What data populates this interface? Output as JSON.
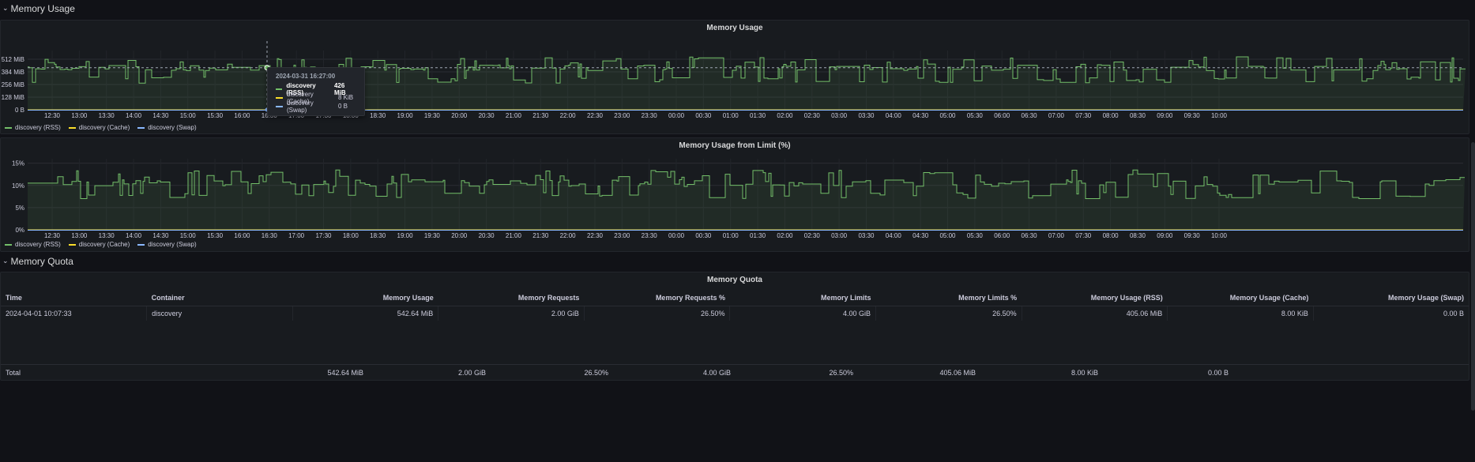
{
  "rows": {
    "memory_usage": "Memory Usage",
    "memory_quota": "Memory Quota"
  },
  "legend": [
    {
      "name": "discovery (RSS)",
      "color": "#73bf69"
    },
    {
      "name": "discovery (Cache)",
      "color": "#fade2a"
    },
    {
      "name": "discovery (Swap)",
      "color": "#8ab8ff"
    }
  ],
  "x_ticks": [
    "12:30",
    "13:00",
    "13:30",
    "14:00",
    "14:30",
    "15:00",
    "15:30",
    "16:00",
    "16:30",
    "17:00",
    "17:30",
    "18:00",
    "18:30",
    "19:00",
    "19:30",
    "20:00",
    "20:30",
    "21:00",
    "21:30",
    "22:00",
    "22:30",
    "23:00",
    "23:30",
    "00:00",
    "00:30",
    "01:00",
    "01:30",
    "02:00",
    "02:30",
    "03:00",
    "03:30",
    "04:00",
    "04:30",
    "05:00",
    "05:30",
    "06:00",
    "06:30",
    "07:00",
    "07:30",
    "08:00",
    "08:30",
    "09:00",
    "09:30",
    "10:00"
  ],
  "panel1": {
    "title": "Memory Usage",
    "y_ticks": [
      "0 B",
      "128 MiB",
      "256 MiB",
      "384 MiB",
      "512 MiB"
    ],
    "tooltip": {
      "time": "2024-03-31 16:27:00",
      "rows": [
        {
          "name": "discovery (RSS)",
          "value": "426 MiB",
          "color": "#73bf69"
        },
        {
          "name": "discovery (Cache)",
          "value": "8 KiB",
          "color": "#fade2a"
        },
        {
          "name": "discovery (Swap)",
          "value": "0 B",
          "color": "#8ab8ff"
        }
      ]
    }
  },
  "panel2": {
    "title": "Memory Usage from Limit (%)",
    "y_ticks": [
      "0%",
      "5%",
      "10%",
      "15%"
    ]
  },
  "quota": {
    "title": "Memory Quota",
    "columns": [
      "Time",
      "Container",
      "Memory Usage",
      "Memory Requests",
      "Memory Requests %",
      "Memory Limits",
      "Memory Limits %",
      "Memory Usage (RSS)",
      "Memory Usage (Cache)",
      "Memory Usage (Swap)"
    ],
    "row": [
      "2024-04-01 10:07:33",
      "discovery",
      "542.64 MiB",
      "2.00 GiB",
      "26.50%",
      "4.00 GiB",
      "26.50%",
      "405.06 MiB",
      "8.00 KiB",
      "0.00 B"
    ],
    "total": [
      "Total",
      "",
      "542.64 MiB",
      "2.00 GiB",
      "26.50%",
      "4.00 GiB",
      "26.50%",
      "405.06 MiB",
      "8.00 KiB",
      "0.00 B"
    ]
  },
  "chart_data": [
    {
      "type": "line",
      "title": "Memory Usage",
      "ylim": [
        0,
        600
      ],
      "series": [
        {
          "name": "discovery (RSS)",
          "typical": 430,
          "range": [
            270,
            540
          ]
        },
        {
          "name": "discovery (Cache)",
          "typical": 0
        },
        {
          "name": "discovery (Swap)",
          "typical": 0
        }
      ]
    },
    {
      "type": "line",
      "title": "Memory Usage from Limit (%)",
      "ylim": [
        0,
        16
      ],
      "series": [
        {
          "name": "discovery (RSS)",
          "typical": 10.5,
          "range": [
            7,
            13.5
          ]
        },
        {
          "name": "discovery (Cache)",
          "typical": 0
        },
        {
          "name": "discovery (Swap)",
          "typical": 0
        }
      ]
    }
  ]
}
